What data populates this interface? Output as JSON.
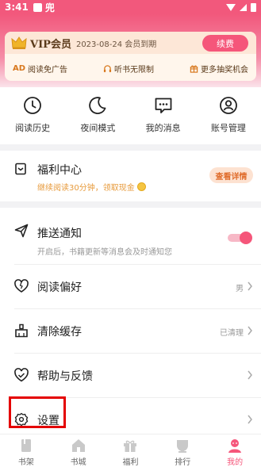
{
  "status_bar": {
    "time": "3:41",
    "app_label": "兜"
  },
  "vip": {
    "title": "VIP会员",
    "expire_text": "2023-08-24 会员到期",
    "renew_label": "续费",
    "perks": [
      {
        "badge": "AD",
        "label": "阅读免广告",
        "icon": "ad-badge"
      },
      {
        "label": "听书无限制",
        "icon": "headphones-icon"
      },
      {
        "label": "更多抽奖机会",
        "icon": "gift-icon"
      }
    ]
  },
  "quick_actions": [
    {
      "label": "阅读历史",
      "icon": "clock-icon"
    },
    {
      "label": "夜间模式",
      "icon": "moon-icon"
    },
    {
      "label": "我的消息",
      "icon": "message-icon"
    },
    {
      "label": "账号管理",
      "icon": "account-icon"
    }
  ],
  "welfare": {
    "title": "福利中心",
    "subtitle": "继续阅读30分钟，领取现金",
    "detail_label": "查看详情"
  },
  "settings": {
    "push": {
      "title": "推送通知",
      "subtitle": "开启后，书籍更新等消息会及时通知您",
      "enabled": true
    },
    "reading_pref": {
      "title": "阅读偏好",
      "value": "男"
    },
    "clear_cache": {
      "title": "清除缓存",
      "value": "已清理"
    },
    "help": {
      "title": "帮助与反馈"
    },
    "settings": {
      "title": "设置"
    }
  },
  "tabs": [
    {
      "label": "书架",
      "icon": "bookshelf-icon",
      "active": false
    },
    {
      "label": "书城",
      "icon": "store-icon",
      "active": false
    },
    {
      "label": "福利",
      "icon": "welfare-icon",
      "active": false
    },
    {
      "label": "排行",
      "icon": "ranking-icon",
      "active": false
    },
    {
      "label": "我的",
      "icon": "profile-icon",
      "active": true
    }
  ],
  "colors": {
    "accent": "#f5567a",
    "header": "#f2587c",
    "vip_text": "#5a3a1a",
    "welfare_accent": "#e79a3b"
  }
}
